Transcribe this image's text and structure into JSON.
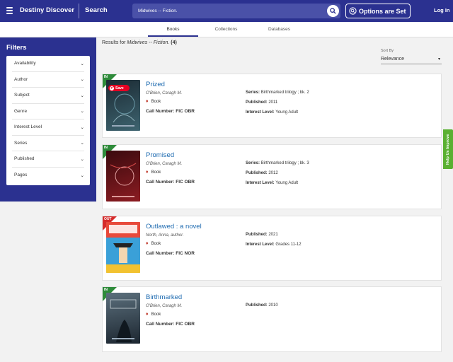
{
  "header": {
    "brand": "Destiny Discover",
    "search_label": "Search",
    "search_value": "Midwives -- Fiction.",
    "options_label": "Options are Set",
    "login_label": "Log In"
  },
  "tabs": [
    {
      "label": "Books",
      "active": true
    },
    {
      "label": "Collections",
      "active": false
    },
    {
      "label": "Databases",
      "active": false
    }
  ],
  "filters": {
    "title": "Filters",
    "items": [
      "Availability",
      "Author",
      "Subject",
      "Genre",
      "Interest Level",
      "Series",
      "Published",
      "Pages"
    ]
  },
  "results": {
    "prefix": "Results for ",
    "query": "Midwives -- Fiction.",
    "count": "(4)",
    "sort_label": "Sort By",
    "sort_value": "Relevance"
  },
  "labels": {
    "call_number": "Call Number:",
    "series": "Series:",
    "published": "Published:",
    "interest_level": "Interest Level:",
    "save": "Save"
  },
  "books": [
    {
      "status": "IN",
      "status_color": "#2e8b3a",
      "title": "Prized",
      "author": "O'Brien, Caragh M.",
      "format": "Book",
      "call_number": "FIC OBR",
      "series": "Birthmarked trilogy ; bk. 2",
      "published": "2011",
      "interest_level": "Young Adult",
      "cover_colors": [
        "#1b2a33",
        "#3e6470"
      ]
    },
    {
      "status": "IN",
      "status_color": "#2e8b3a",
      "title": "Promised",
      "author": "O'Brien, Caragh M.",
      "format": "Book",
      "call_number": "FIC OBR",
      "series": "Birthmarked trilogy ; bk. 3",
      "published": "2012",
      "interest_level": "Young Adult",
      "cover_colors": [
        "#3a0a0e",
        "#8c1c22"
      ]
    },
    {
      "status": "OUT",
      "status_color": "#d62b2b",
      "title": "Outlawed : a novel",
      "author": "North, Anna, author.",
      "format": "Book",
      "call_number": "FIC NOR",
      "published": "2021",
      "interest_level": "Grades 11-12",
      "cover_colors": [
        "#e8493a",
        "#3aa0d8"
      ]
    },
    {
      "status": "IN",
      "status_color": "#2e8b3a",
      "title": "Birthmarked",
      "author": "O'Brien, Caragh M.",
      "format": "Book",
      "call_number": "FIC OBR",
      "published": "2010",
      "cover_colors": [
        "#1c2630",
        "#5b6f7c"
      ]
    }
  ],
  "help_label": "Help Us Improve"
}
